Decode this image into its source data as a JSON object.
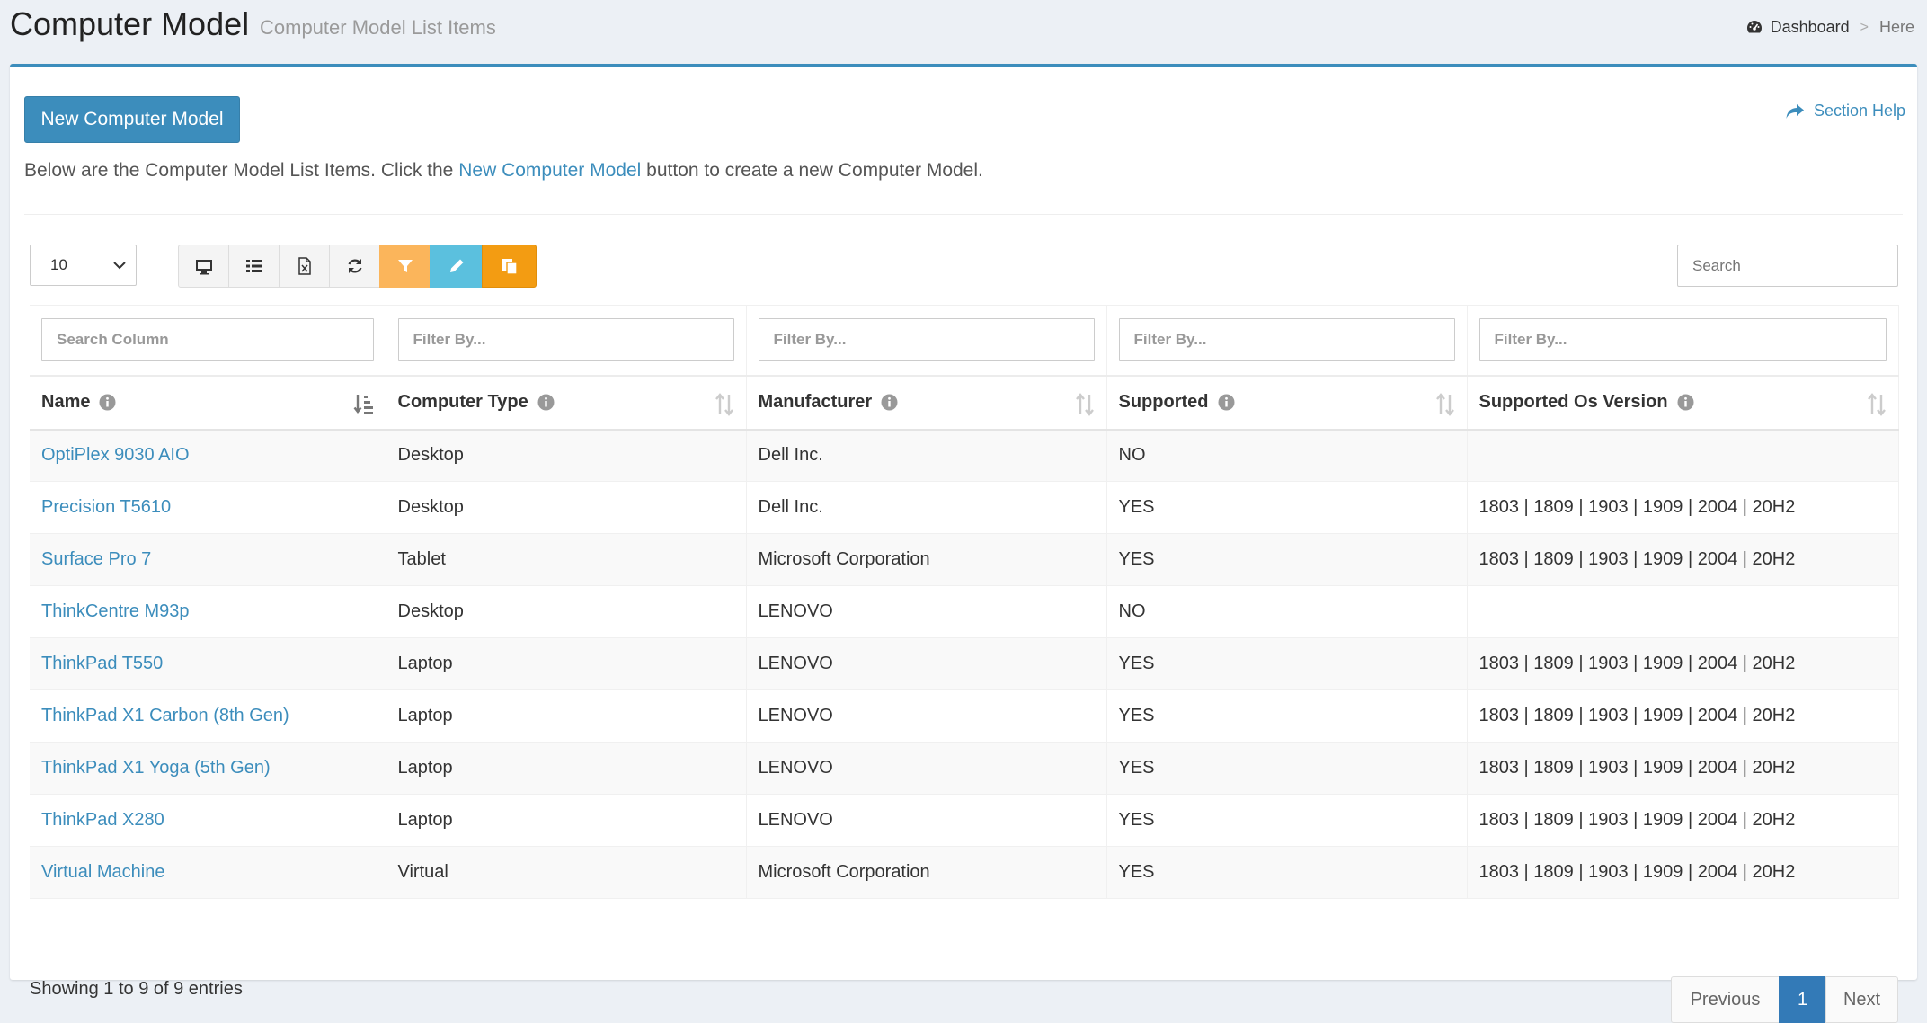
{
  "header": {
    "title": "Computer Model",
    "subtitle": "Computer Model List Items",
    "breadcrumb": {
      "dashboard": "Dashboard",
      "separator": ">",
      "here": "Here"
    }
  },
  "toolbar": {
    "new_button": "New Computer Model",
    "section_help": "Section Help",
    "intro_before": "Below are the Computer Model List Items. Click the",
    "intro_link": "New Computer Model",
    "intro_after": "button to create a new Computer Model.",
    "page_length": "10",
    "search_placeholder": "Search",
    "icons": [
      "monitor-icon",
      "list-icon",
      "excel-icon",
      "refresh-icon",
      "filter-icon",
      "pencil-icon",
      "copy-icon"
    ]
  },
  "table": {
    "filters": [
      "Search Column",
      "Filter By...",
      "Filter By...",
      "Filter By...",
      "Filter By..."
    ],
    "columns": [
      "Name",
      "Computer Type",
      "Manufacturer",
      "Supported",
      "Supported Os Version"
    ],
    "rows": [
      {
        "name": "OptiPlex 9030 AIO",
        "type": "Desktop",
        "manufacturer": "Dell Inc.",
        "supported": "NO",
        "os": ""
      },
      {
        "name": "Precision T5610",
        "type": "Desktop",
        "manufacturer": "Dell Inc.",
        "supported": "YES",
        "os": "1803 | 1809 | 1903 | 1909 | 2004 | 20H2"
      },
      {
        "name": "Surface Pro 7",
        "type": "Tablet",
        "manufacturer": "Microsoft Corporation",
        "supported": "YES",
        "os": "1803 | 1809 | 1903 | 1909 | 2004 | 20H2"
      },
      {
        "name": "ThinkCentre M93p",
        "type": "Desktop",
        "manufacturer": "LENOVO",
        "supported": "NO",
        "os": ""
      },
      {
        "name": "ThinkPad T550",
        "type": "Laptop",
        "manufacturer": "LENOVO",
        "supported": "YES",
        "os": "1803 | 1809 | 1903 | 1909 | 2004 | 20H2"
      },
      {
        "name": "ThinkPad X1 Carbon (8th Gen)",
        "type": "Laptop",
        "manufacturer": "LENOVO",
        "supported": "YES",
        "os": "1803 | 1809 | 1903 | 1909 | 2004 | 20H2"
      },
      {
        "name": "ThinkPad X1 Yoga (5th Gen)",
        "type": "Laptop",
        "manufacturer": "LENOVO",
        "supported": "YES",
        "os": "1803 | 1809 | 1903 | 1909 | 2004 | 20H2"
      },
      {
        "name": "ThinkPad X280",
        "type": "Laptop",
        "manufacturer": "LENOVO",
        "supported": "YES",
        "os": "1803 | 1809 | 1903 | 1909 | 2004 | 20H2"
      },
      {
        "name": "Virtual Machine",
        "type": "Virtual",
        "manufacturer": "Microsoft Corporation",
        "supported": "YES",
        "os": "1803 | 1809 | 1903 | 1909 | 2004 | 20H2"
      }
    ]
  },
  "footer": {
    "info": "Showing 1 to 9 of 9 entries",
    "previous": "Previous",
    "current_page": "1",
    "next": "Next"
  },
  "colors": {
    "primary": "#3c8dbc",
    "filter_button": "#fbb55b",
    "edit_button": "#5bc0de",
    "copy_button": "#f39c12",
    "page_active": "#337ab7"
  }
}
